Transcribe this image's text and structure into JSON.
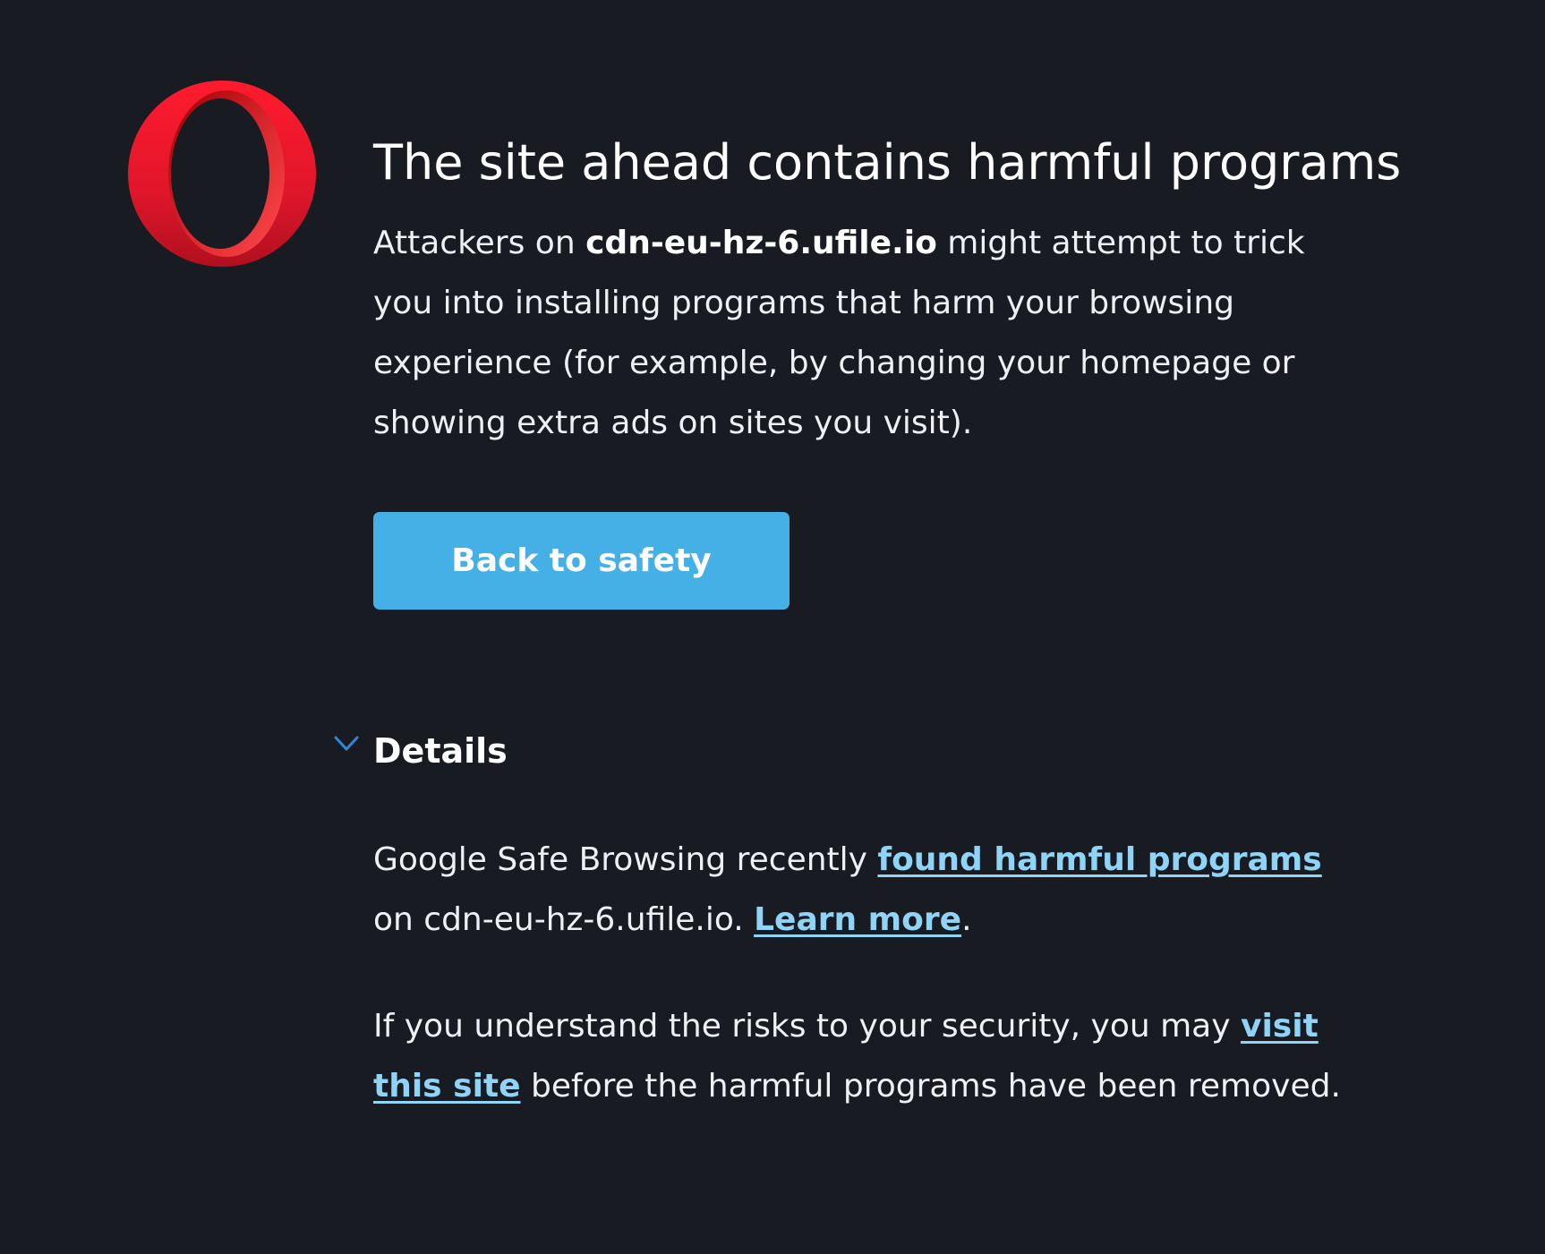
{
  "brand": {
    "logo": "opera-logo",
    "logo_color": "#e0162b"
  },
  "warning": {
    "title": "The site ahead contains harmful programs",
    "para_prefix": "Attackers on ",
    "domain": "cdn-eu-hz-6.ufile.io",
    "para_suffix": " might attempt to trick you into installing programs that harm your browsing experience (for example, by changing your homepage or showing extra ads on sites you visit)."
  },
  "actions": {
    "back_label": "Back to safety",
    "back_color": "#45b0e6"
  },
  "details": {
    "toggle_icon": "chevron-down-icon",
    "label": "Details",
    "p1_prefix": "Google Safe Browsing recently ",
    "p1_link": "found harmful programs",
    "p1_middle": " on cdn-eu-hz-6.ufile.io. ",
    "p1_link2": "Learn more",
    "p1_suffix": ".",
    "p2_prefix": "If you understand the risks to your security, you may ",
    "p2_link": "visit this site",
    "p2_suffix": " before the harmful programs have been removed.",
    "link_color": "#8fd4f7"
  }
}
